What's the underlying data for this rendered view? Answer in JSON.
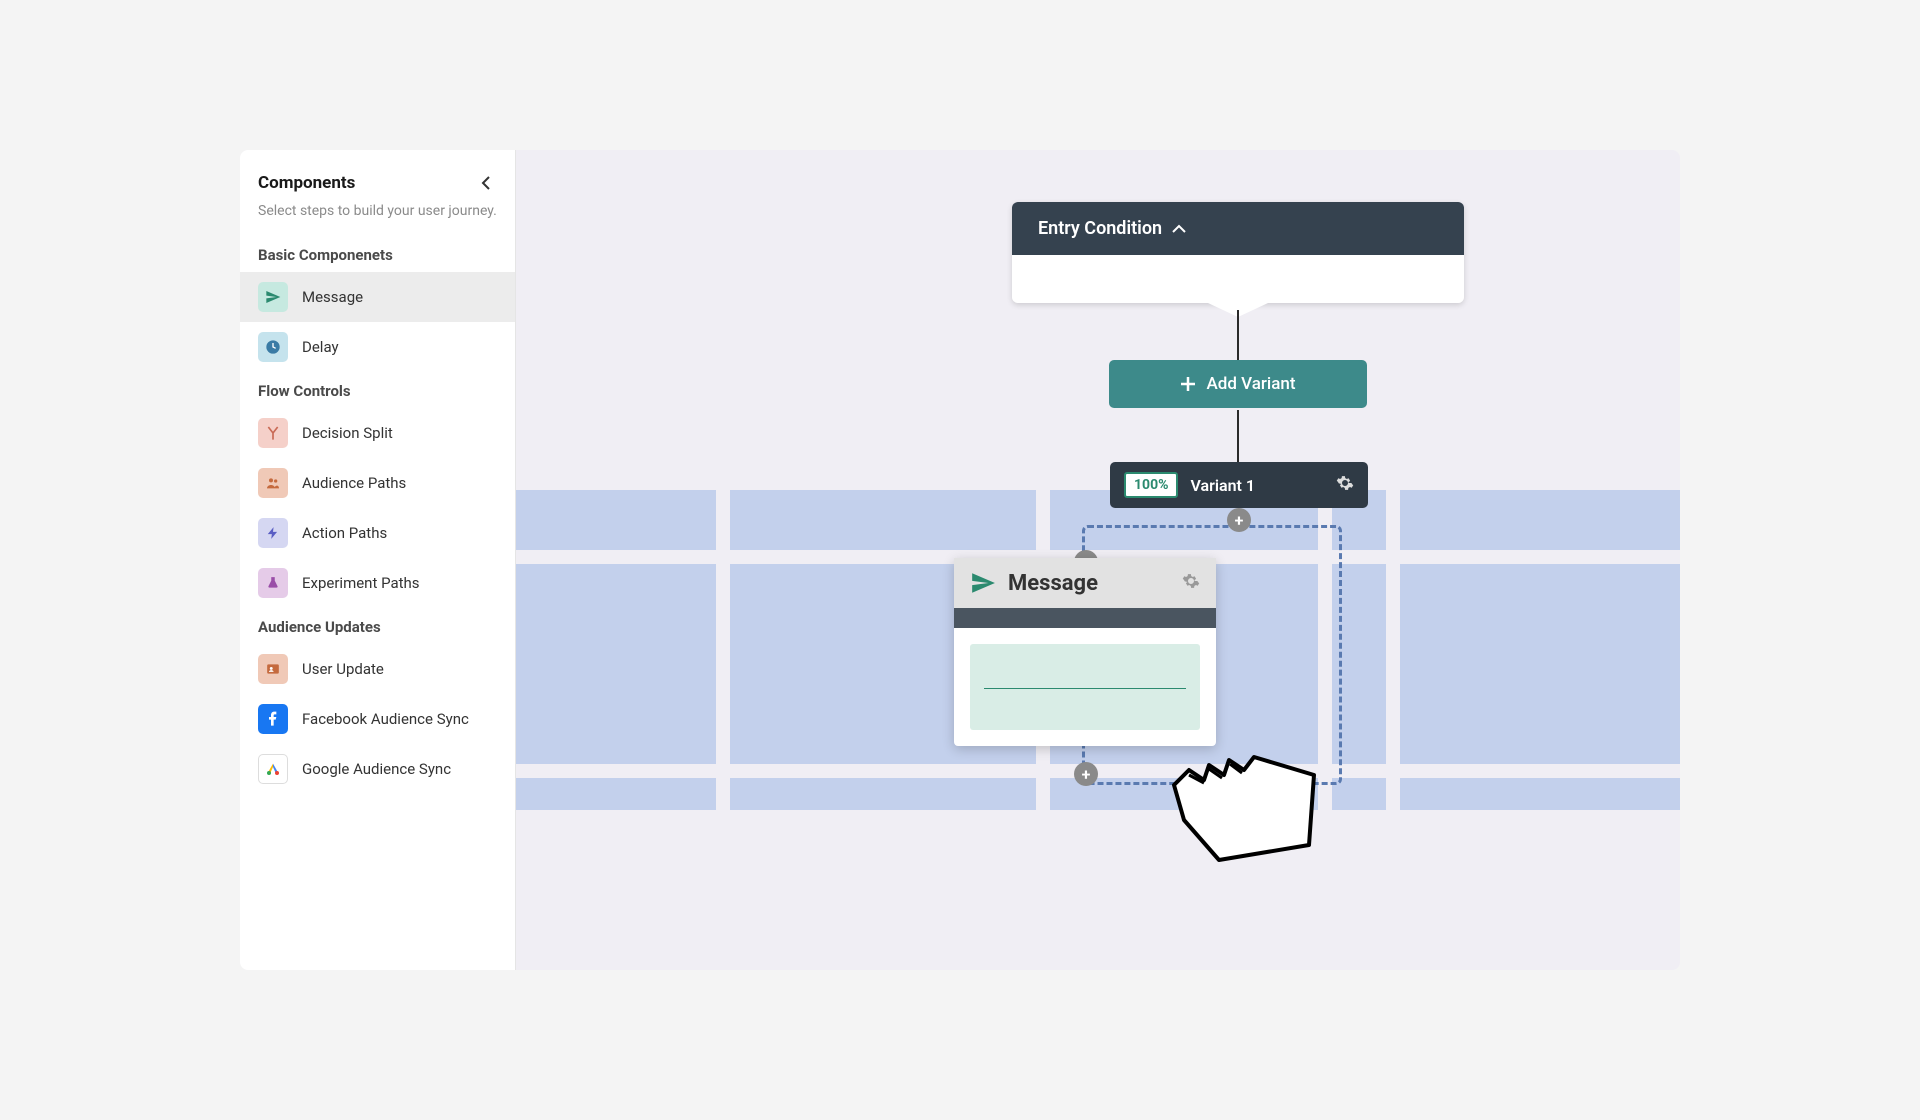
{
  "sidebar": {
    "title": "Components",
    "description": "Select steps to build your user journey.",
    "sections": [
      {
        "label": "Basic Componenets",
        "items": [
          {
            "label": "Message",
            "icon": "paper-plane",
            "cls": "ic-message"
          },
          {
            "label": "Delay",
            "icon": "clock",
            "cls": "ic-delay"
          }
        ]
      },
      {
        "label": "Flow Controls",
        "items": [
          {
            "label": "Decision Split",
            "icon": "split",
            "cls": "ic-decision"
          },
          {
            "label": "Audience Paths",
            "icon": "users",
            "cls": "ic-audience"
          },
          {
            "label": "Action Paths",
            "icon": "bolt",
            "cls": "ic-action"
          },
          {
            "label": "Experiment Paths",
            "icon": "flask",
            "cls": "ic-experiment"
          }
        ]
      },
      {
        "label": "Audience Updates",
        "items": [
          {
            "label": "User Update",
            "icon": "id",
            "cls": "ic-user"
          },
          {
            "label": "Facebook Audience Sync",
            "icon": "fb",
            "cls": "ic-fb"
          },
          {
            "label": "Google Audience Sync",
            "icon": "google",
            "cls": "ic-google"
          }
        ]
      }
    ]
  },
  "canvas": {
    "entry_label": "Entry Condition",
    "add_variant_label": "Add Variant",
    "variant": {
      "percent": "100%",
      "name": "Variant 1"
    },
    "drag_card": {
      "title": "Message"
    }
  }
}
